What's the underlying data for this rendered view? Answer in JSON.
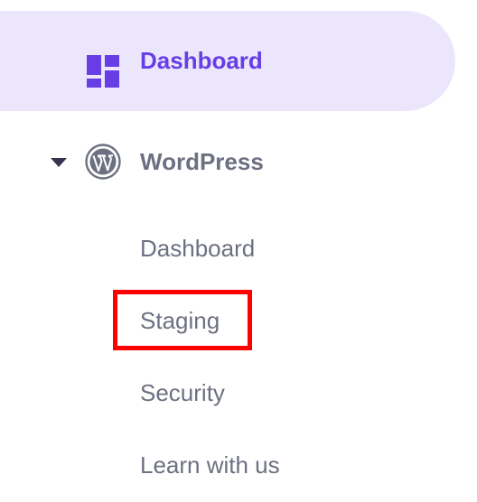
{
  "sidebar": {
    "active_item": {
      "label": "Dashboard",
      "icon": "dashboard-grid-icon"
    },
    "group": {
      "label": "WordPress",
      "icon": "wordpress-icon",
      "expanded": true,
      "items": [
        {
          "label": "Dashboard"
        },
        {
          "label": "Staging"
        },
        {
          "label": "Security"
        },
        {
          "label": "Learn with us"
        }
      ]
    }
  },
  "colors": {
    "accent": "#673de6",
    "active_background": "#ebe6fb",
    "text_muted": "#6d7081",
    "highlight": "#ff0000"
  }
}
